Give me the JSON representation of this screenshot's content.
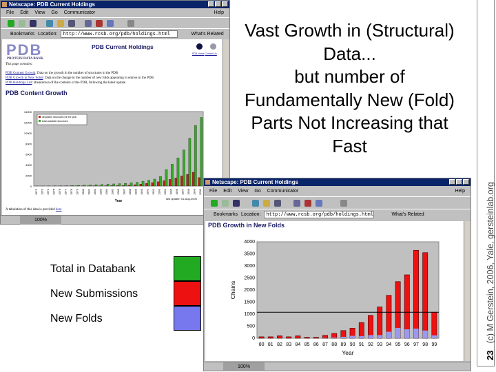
{
  "slide": {
    "title_lines": [
      "Vast Growth in (Structural)",
      "Data...",
      "but number of",
      "Fundamentally New (Fold)",
      "Parts Not Increasing that",
      "Fast"
    ],
    "slide_number": "23",
    "credit": "(c) M Gerstein, 2006, Yale, gersteinlab.org",
    "legend": [
      {
        "label": "Total in Databank",
        "color": "#22aa22"
      },
      {
        "label": "New Submissions",
        "color": "#ee1111"
      },
      {
        "label": "New Folds",
        "color": "#7777ee"
      }
    ]
  },
  "window1": {
    "title": "Netscape: PDB Current Holdings",
    "menu": [
      "File",
      "Edit",
      "View",
      "Go",
      "Communicator"
    ],
    "help": "Help",
    "bookmarks": "Bookmarks",
    "location_label": "Location:",
    "url": "http://www.rcsb.org/pdb/holdings.html",
    "whats_related": "What's Related",
    "logo": "PDB",
    "logo_sub": "PROTEIN DATA BANK",
    "page_title": "PDB Current Holdings",
    "top_links": [
      "PDB Home",
      "Contact Us"
    ],
    "intro": "This page contains:",
    "links": [
      {
        "label": "PDB Content Growth",
        "desc": ": Data on the growth in the number of structures in the PDB"
      },
      {
        "label": "PDB Growth in New Folds",
        "desc": ": Data on the change in the number of new folds appearing in entries in the PDB"
      },
      {
        "label": "PDB Holdings List",
        "desc": ": Breakdown of the contents of the PDB, following the latest update"
      }
    ],
    "section_title": "PDB Content Growth",
    "last_update": "last update: 01-Aug-2000",
    "tabulation": "A tabulation of this data is provided ",
    "tabulation_link": "here",
    "status_pct": "100%"
  },
  "window2": {
    "title": "Netscape: PDB Current Holdings",
    "menu": [
      "File",
      "Edit",
      "View",
      "Go",
      "Communicator"
    ],
    "help": "Help",
    "bookmarks": "Bookmarks",
    "location_label": "Location:",
    "url": "http://www.rcsb.org/pdb/holdings.html",
    "whats_related": "What's Related",
    "section_title": "PDB Growth in New Folds",
    "status_pct": "100%"
  },
  "chart_data": [
    {
      "type": "bar",
      "xlabel": "Year",
      "ylabel": "",
      "ylim": [
        0,
        14000
      ],
      "yticks": [
        0,
        2000,
        4000,
        6000,
        8000,
        10000,
        12000,
        14000
      ],
      "legend_placement": "top-left",
      "categories": [
        "1972",
        "1973",
        "1974",
        "1975",
        "1976",
        "1977",
        "1978",
        "1979",
        "1980",
        "1981",
        "1982",
        "1983",
        "1984",
        "1985",
        "1986",
        "1987",
        "1988",
        "1989",
        "1990",
        "1991",
        "1992",
        "1993",
        "1994",
        "1995",
        "1996",
        "1997",
        "1998",
        "1999",
        "2000"
      ],
      "series": [
        {
          "name": "deposited structures for the year",
          "color": "#bb2211",
          "values": [
            1,
            1,
            1,
            5,
            10,
            15,
            20,
            25,
            30,
            40,
            50,
            50,
            60,
            70,
            80,
            100,
            150,
            250,
            350,
            500,
            650,
            800,
            1000,
            1250,
            1500,
            1900,
            2200,
            2600,
            1600
          ]
        },
        {
          "name": "total available structures",
          "color": "#33aa22",
          "values": [
            10,
            12,
            15,
            25,
            40,
            60,
            90,
            120,
            150,
            200,
            250,
            300,
            350,
            400,
            450,
            500,
            600,
            700,
            900,
            1100,
            1300,
            1800,
            3100,
            4100,
            5300,
            6800,
            9000,
            11400,
            12900
          ]
        }
      ]
    },
    {
      "type": "bar",
      "xlabel": "Year",
      "ylabel": "Chains",
      "ylim": [
        0,
        4000
      ],
      "yticks": [
        0,
        500,
        1000,
        1500,
        2000,
        2500,
        3000,
        3500,
        4000
      ],
      "reference_line": 1080,
      "categories": [
        "80",
        "81",
        "82",
        "83",
        "84",
        "85",
        "86",
        "87",
        "88",
        "89",
        "90",
        "91",
        "92",
        "93",
        "94",
        "95",
        "96",
        "97",
        "98",
        "99"
      ],
      "series": [
        {
          "color": "#ee1111",
          "values": [
            60,
            60,
            100,
            60,
            100,
            40,
            40,
            120,
            200,
            320,
            420,
            650,
            950,
            1300,
            1780,
            2350,
            2630,
            3650,
            3550,
            1080
          ]
        },
        {
          "color": "#9999ee",
          "values": [
            0,
            0,
            0,
            0,
            0,
            0,
            0,
            10,
            30,
            60,
            100,
            90,
            130,
            130,
            270,
            430,
            370,
            400,
            320,
            120
          ]
        }
      ]
    }
  ]
}
